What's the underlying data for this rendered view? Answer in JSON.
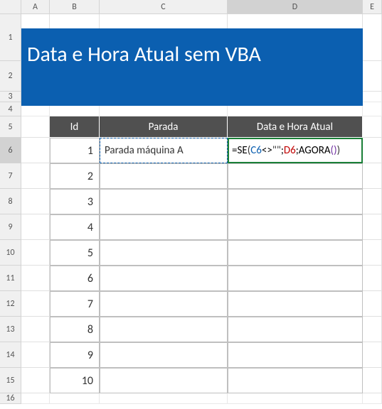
{
  "columns": [
    "A",
    "B",
    "C",
    "D",
    "E"
  ],
  "title": "Data e Hora Atual sem VBA",
  "table": {
    "headers": {
      "id": "Id",
      "parada": "Parada",
      "dh": "Data e Hora Atual"
    },
    "rows": [
      {
        "id": "1",
        "parada": "Parada máquina A",
        "dh_formula": {
          "eq": "=",
          "fn": "SE",
          "open": "(",
          "r1": "C6",
          "op": "<>",
          "str": "\"\"",
          "sep1": ";",
          "r2": "D6",
          "sep2": ";",
          "fn2": "AGORA",
          "open2": "(",
          "close2": ")",
          "close": ")"
        }
      },
      {
        "id": "2",
        "parada": "",
        "dh": ""
      },
      {
        "id": "3",
        "parada": "",
        "dh": ""
      },
      {
        "id": "4",
        "parada": "",
        "dh": ""
      },
      {
        "id": "5",
        "parada": "",
        "dh": ""
      },
      {
        "id": "6",
        "parada": "",
        "dh": ""
      },
      {
        "id": "7",
        "parada": "",
        "dh": ""
      },
      {
        "id": "8",
        "parada": "",
        "dh": ""
      },
      {
        "id": "9",
        "parada": "",
        "dh": ""
      },
      {
        "id": "10",
        "parada": "",
        "dh": ""
      }
    ]
  },
  "row_labels": [
    "1",
    "2",
    "3",
    "4",
    "5",
    "6",
    "7",
    "8",
    "9",
    "10",
    "11",
    "12",
    "13",
    "14",
    "15",
    "16"
  ]
}
